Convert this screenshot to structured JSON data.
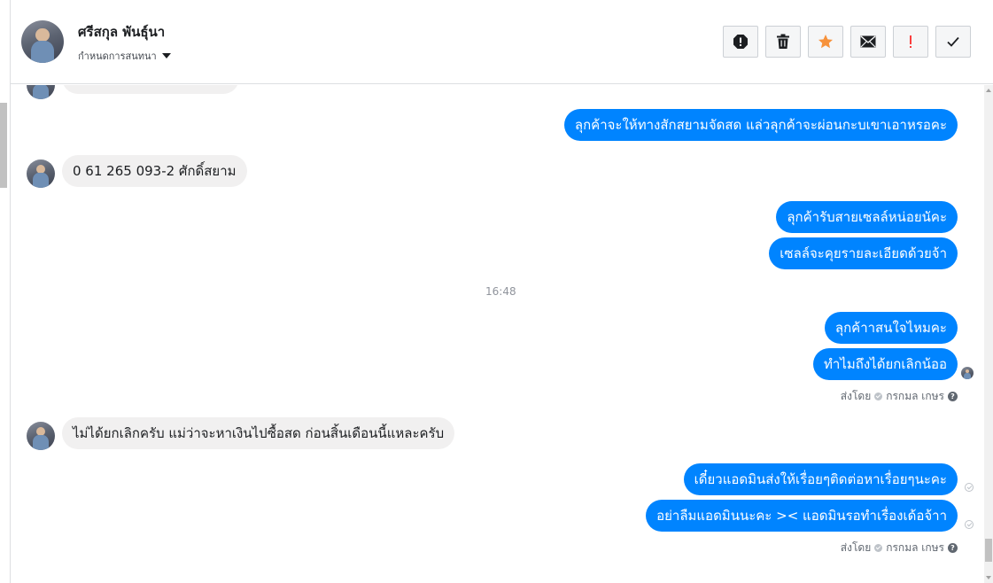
{
  "header": {
    "name": "ศรีสกุล พันธุ์นา",
    "subtitle": "กำหนดการสนทนา",
    "actions": [
      {
        "name": "report-icon",
        "label": "!"
      },
      {
        "name": "trash-icon",
        "label": "delete"
      },
      {
        "name": "star-icon",
        "label": "star"
      },
      {
        "name": "mail-icon",
        "label": "mail"
      },
      {
        "name": "exclamation-icon",
        "label": "!"
      },
      {
        "name": "check-icon",
        "label": "done"
      }
    ]
  },
  "colors": {
    "outgoing": "#0084ff",
    "incoming": "#f1f0f0",
    "star": "#f7923b",
    "exclamation": "#fa3e3e"
  },
  "messages": {
    "out1": "ลุกค้าจะให้ทางสักสยามจัดสด แล่วลุกค้าจะผ่อนกะบเขาเอาหรอคะ",
    "in1": "0 61 265 093-2 ศักดิ์สยาม",
    "out2": "ลุกค้ารับสายเซลล์หน่อยนัคะ",
    "out3": "เซลล์จะคุยรายละเอียดด้วยจ้า",
    "time1": "16:48",
    "out4": "ลุกค้าาสนใจไหมคะ",
    "out5": "ทำไมถึงได้ยกเลิกน้ออ",
    "in2": "ไม่ได้ยกเลิกครับ แม่ว่าจะหาเงินไปซื้อสด ก่อนสิ้นเดือนนี้แหละครับ",
    "out6": "เดี๋ยวแอดมินส่งให้เรื่อยๆติดต่อหาเรื่อยๆนะคะ",
    "out7": "อย่าลืมแอดมินนะคะ >< แอดมินรอทำเรื่องเด้อจ้าา"
  },
  "sent_by": {
    "label": "ส่งโดย",
    "agent": "กรกมล เกษร"
  }
}
